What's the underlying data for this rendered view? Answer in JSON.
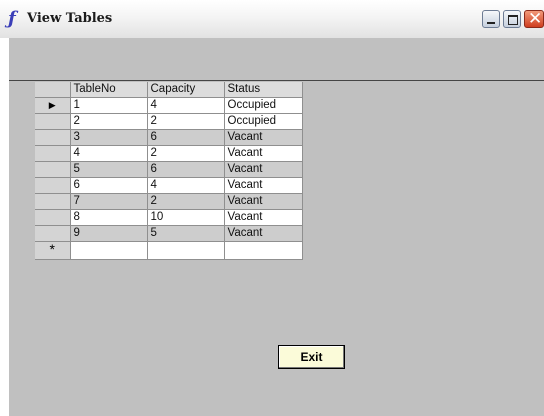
{
  "window": {
    "title": "View Tables",
    "icon_glyph": "ƒ",
    "controls": {
      "minimize": "minimize-icon",
      "maximize": "maximize-icon",
      "close_glyph": "✕"
    }
  },
  "grid": {
    "columns": [
      "TableNo",
      "Capacity",
      "Status"
    ],
    "rows": [
      {
        "table_no": "1",
        "capacity": "4",
        "status": "Occupied"
      },
      {
        "table_no": "2",
        "capacity": "2",
        "status": "Occupied"
      },
      {
        "table_no": "3",
        "capacity": "6",
        "status": "Vacant"
      },
      {
        "table_no": "4",
        "capacity": "2",
        "status": "Vacant"
      },
      {
        "table_no": "5",
        "capacity": "6",
        "status": "Vacant"
      },
      {
        "table_no": "6",
        "capacity": "4",
        "status": "Vacant"
      },
      {
        "table_no": "7",
        "capacity": "2",
        "status": "Vacant"
      },
      {
        "table_no": "8",
        "capacity": "10",
        "status": "Vacant"
      },
      {
        "table_no": "9",
        "capacity": "5",
        "status": "Vacant"
      }
    ],
    "current_row_marker": "▶",
    "new_row_marker": "*"
  },
  "buttons": {
    "exit_label": "Exit"
  }
}
